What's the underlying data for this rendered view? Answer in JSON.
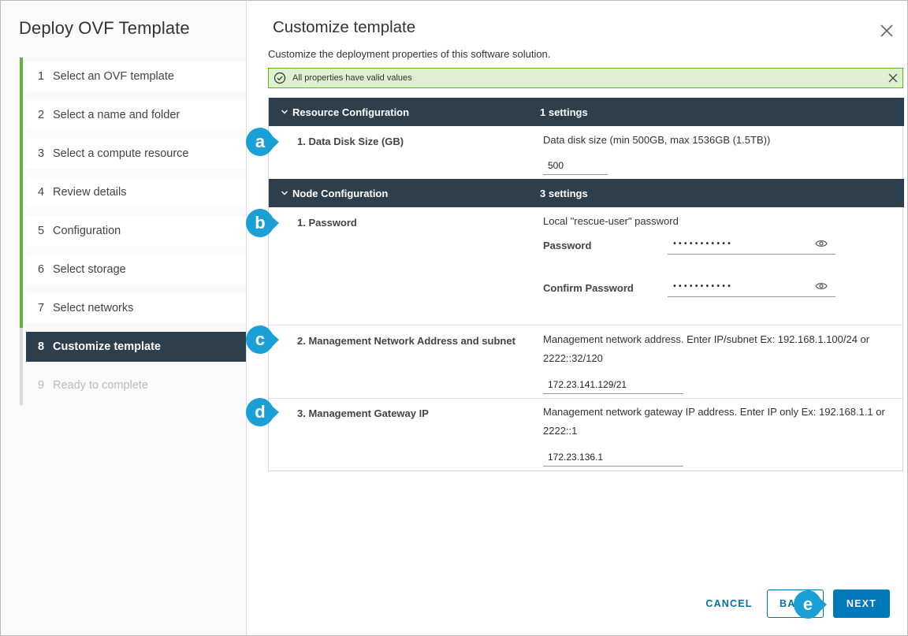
{
  "wizard": {
    "title": "Deploy OVF Template",
    "steps": [
      {
        "num": "1",
        "label": "Select an OVF template"
      },
      {
        "num": "2",
        "label": "Select a name and folder"
      },
      {
        "num": "3",
        "label": "Select a compute resource"
      },
      {
        "num": "4",
        "label": "Review details"
      },
      {
        "num": "5",
        "label": "Configuration"
      },
      {
        "num": "6",
        "label": "Select storage"
      },
      {
        "num": "7",
        "label": "Select networks"
      },
      {
        "num": "8",
        "label": "Customize template"
      },
      {
        "num": "9",
        "label": "Ready to complete"
      }
    ],
    "current_step": 8
  },
  "page": {
    "title": "Customize template",
    "subtitle": "Customize the deployment properties of this software solution.",
    "alert": "All properties have valid values"
  },
  "groups": {
    "resource": {
      "name": "Resource Configuration",
      "count": "1 settings",
      "props": {
        "disk": {
          "label": "1. Data Disk Size (GB)",
          "desc": "Data disk size (min 500GB, max 1536GB (1.5TB))",
          "value": "500"
        }
      }
    },
    "node": {
      "name": "Node Configuration",
      "count": "3 settings",
      "props": {
        "password": {
          "label": "1. Password",
          "desc": "Local \"rescue-user\" password",
          "password_label": "Password",
          "password_value": "•••••••••••",
          "confirm_label": "Confirm Password",
          "confirm_value": "•••••••••••"
        },
        "mgmt_addr": {
          "label": "2. Management Network Address and subnet",
          "desc": "Management network address. Enter IP/subnet Ex: 192.168.1.100/24 or 2222::32/120",
          "value": "172.23.141.129/21"
        },
        "gateway": {
          "label": "3. Management Gateway IP",
          "desc": "Management network gateway IP address. Enter IP only Ex: 192.168.1.1 or 2222::1",
          "value": "172.23.136.1"
        }
      }
    }
  },
  "callouts": {
    "a": "a",
    "b": "b",
    "c": "c",
    "d": "d",
    "e": "e"
  },
  "footer": {
    "cancel": "CANCEL",
    "back": "BACK",
    "next": "NEXT"
  },
  "colors": {
    "sidebar_current": "#2d3e4c",
    "step_done": "#61b33d",
    "group_header": "#2d3e4c",
    "alert_bg": "#dff0d0",
    "alert_border": "#60b515",
    "primary": "#0079b8",
    "callout": "#1aa0d6"
  },
  "icons": {
    "close": "close-icon",
    "alert": "check-circle-icon",
    "chevron": "chevron-down-icon",
    "eye": "eye-icon"
  }
}
